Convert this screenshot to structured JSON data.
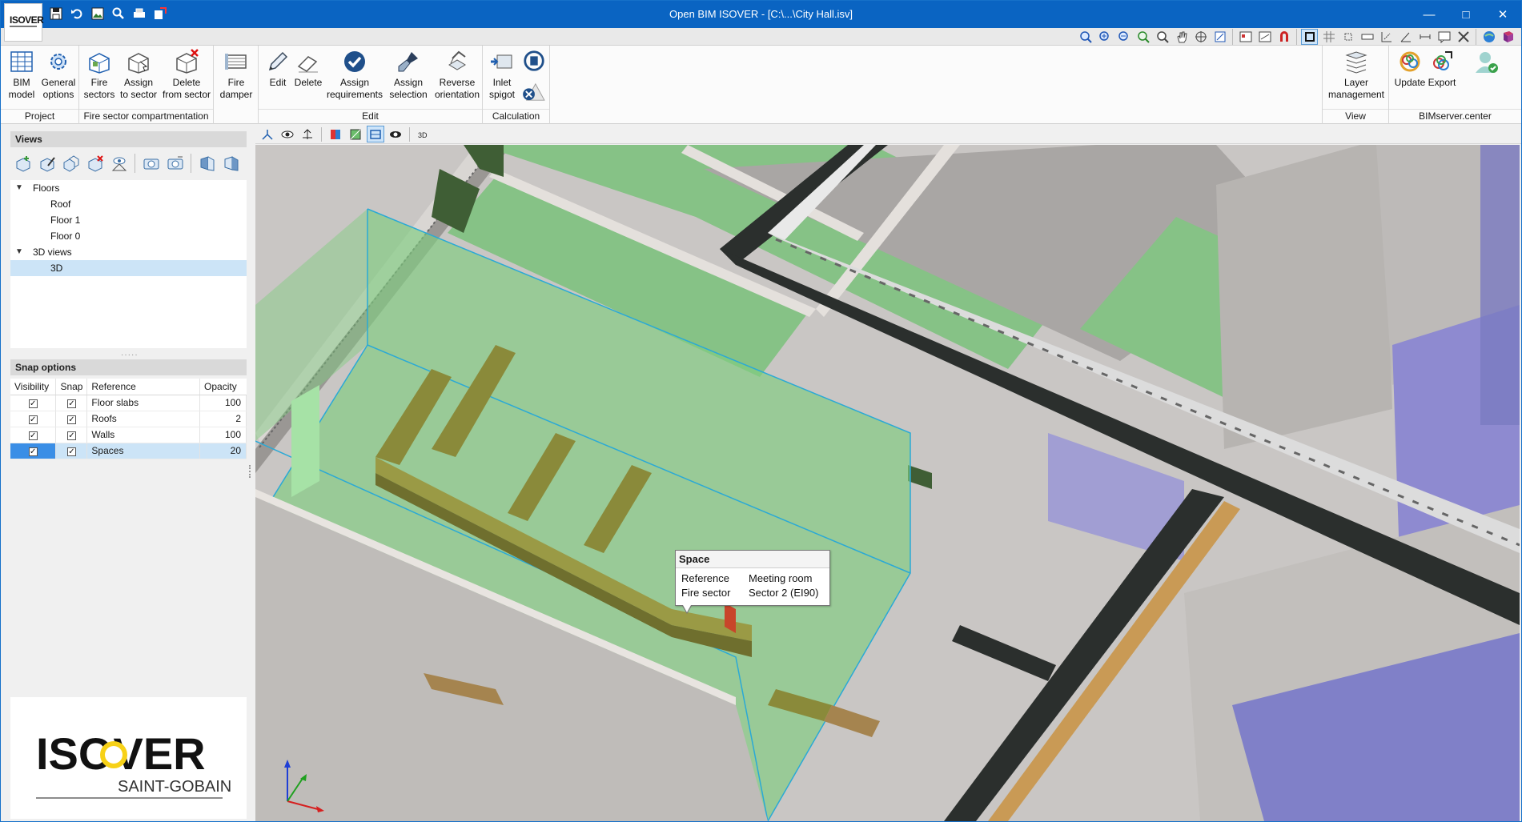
{
  "window": {
    "title": "Open BIM ISOVER - [C:\\...\\City Hall.isv]",
    "app_logo": "isover-small-logo"
  },
  "quick_access": [
    "save-icon",
    "undo-icon",
    "image-icon",
    "search-icon",
    "print-icon",
    "export-icon"
  ],
  "ribbon": {
    "groups": {
      "project": "Project",
      "fire_sector": "Fire sector compartmentation",
      "edit": "Edit",
      "calculation": "Calculation",
      "view": "View",
      "bimserver": "BIMserver.center"
    },
    "buttons": {
      "bim_model": [
        "BIM",
        "model"
      ],
      "general_options": [
        "General",
        "options"
      ],
      "fire_sectors": [
        "Fire",
        "sectors"
      ],
      "assign_to_sector": [
        "Assign",
        "to sector"
      ],
      "delete_from_sector": [
        "Delete",
        "from sector"
      ],
      "fire_damper": [
        "Fire",
        "damper"
      ],
      "edit": [
        "Edit"
      ],
      "delete": [
        "Delete"
      ],
      "assign_requirements": [
        "Assign",
        "requirements"
      ],
      "assign_selection": [
        "Assign",
        "selection"
      ],
      "reverse_orientation": [
        "Reverse",
        "orientation"
      ],
      "inlet_spigot": [
        "Inlet",
        "spigot"
      ],
      "layer_management": [
        "Layer",
        "management"
      ],
      "update": [
        "Update"
      ],
      "export": [
        "Export"
      ]
    }
  },
  "left_panel": {
    "views_header": "Views",
    "tree": [
      {
        "label": "Floors",
        "level": 0,
        "expanded": true
      },
      {
        "label": "Roof",
        "level": 1
      },
      {
        "label": "Floor 1",
        "level": 1
      },
      {
        "label": "Floor 0",
        "level": 1
      },
      {
        "label": "3D views",
        "level": 0,
        "expanded": true
      },
      {
        "label": "3D",
        "level": 1,
        "selected": true
      }
    ],
    "snap_header": "Snap options",
    "snap_columns": [
      "Visibility",
      "Snap",
      "Reference",
      "Opacity"
    ],
    "snap_rows": [
      {
        "reference": "Floor slabs",
        "opacity": "100",
        "visibility": true,
        "snap": true
      },
      {
        "reference": "Roofs",
        "opacity": "2",
        "visibility": true,
        "snap": true
      },
      {
        "reference": "Walls",
        "opacity": "100",
        "visibility": true,
        "snap": true
      },
      {
        "reference": "Spaces",
        "opacity": "20",
        "visibility": true,
        "snap": true,
        "selected": true
      }
    ],
    "brand": {
      "name": "ISOVER",
      "sub": "SAINT-GOBAIN"
    }
  },
  "tooltip": {
    "title": "Space",
    "rows": [
      {
        "label": "Reference",
        "value": "Meeting room"
      },
      {
        "label": "Fire sector",
        "value": "Sector 2 (EI90)"
      }
    ]
  },
  "colors": {
    "titlebar": "#0a64c2",
    "selection": "#cce4f7",
    "space_green": "#7fcc7f",
    "duct": "#8a8a3a",
    "wall": "#c9c6c4",
    "dark_beam": "#2b2f2d",
    "blue_space": "#7f7fc8"
  }
}
